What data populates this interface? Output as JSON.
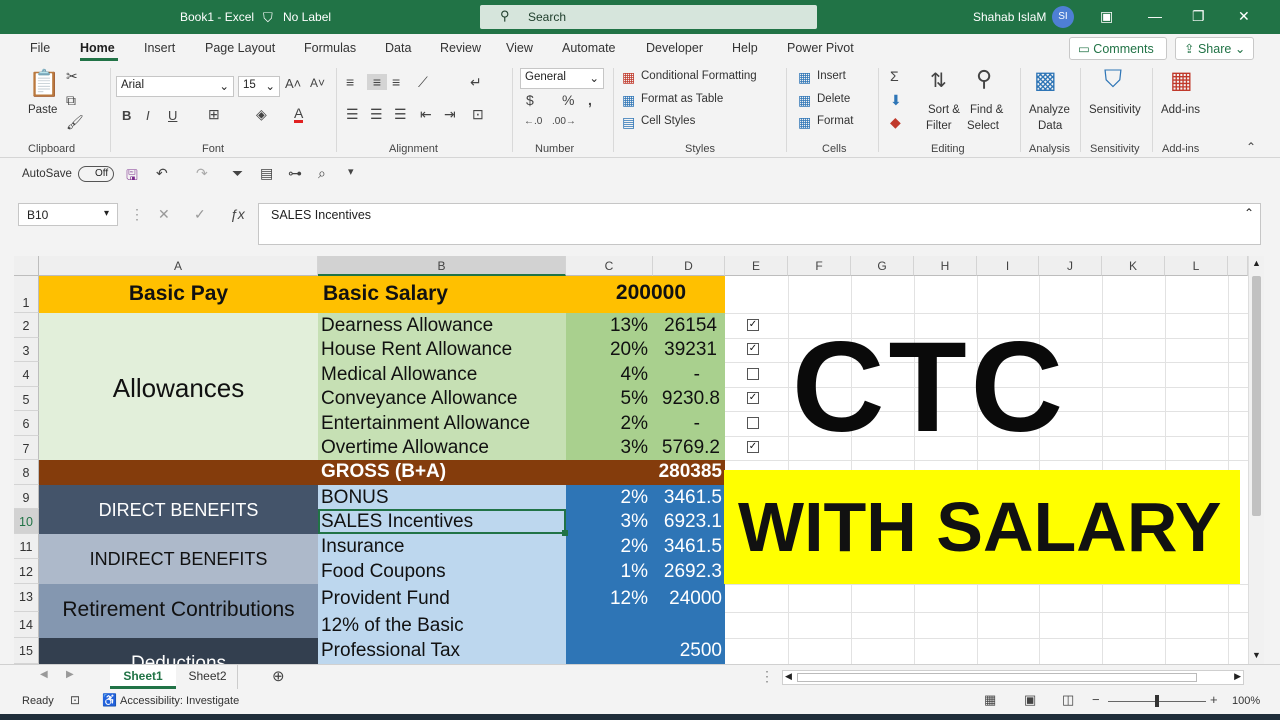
{
  "titlebar": {
    "app_title": "Book1 - Excel",
    "label": "No Label",
    "search_placeholder": "Search",
    "user_name": "Shahab IslaM",
    "user_initials": "SI"
  },
  "menu": [
    "File",
    "Home",
    "Insert",
    "Page Layout",
    "Formulas",
    "Data",
    "Review",
    "View",
    "Automate",
    "Developer",
    "Help",
    "Power Pivot"
  ],
  "top_buttons": {
    "comments": "Comments",
    "share": "Share"
  },
  "ribbon": {
    "clipboard": {
      "paste": "Paste",
      "group": "Clipboard"
    },
    "font": {
      "name": "Arial",
      "size": "15",
      "group": "Font",
      "bold": "B",
      "italic": "I",
      "underline": "U"
    },
    "alignment": {
      "group": "Alignment"
    },
    "number": {
      "format": "General",
      "group": "Number"
    },
    "styles": {
      "conditional": "Conditional Formatting",
      "table": "Format as Table",
      "cell": "Cell Styles",
      "group": "Styles"
    },
    "cells": {
      "insert": "Insert",
      "delete": "Delete",
      "format": "Format",
      "group": "Cells"
    },
    "editing": {
      "sort1": "Sort &",
      "sort2": "Filter",
      "find1": "Find &",
      "find2": "Select",
      "group": "Editing"
    },
    "analysis": {
      "analyze1": "Analyze",
      "analyze2": "Data",
      "group": "Analysis"
    },
    "sensitivity": {
      "label": "Sensitivity",
      "group": "Sensitivity"
    },
    "addins": {
      "label": "Add-ins",
      "group": "Add-ins"
    }
  },
  "qat": {
    "autosave": "AutoSave",
    "toggle": "Off"
  },
  "formula_bar": {
    "name_box": "B10",
    "formula": "SALES Incentives"
  },
  "columns": [
    "A",
    "B",
    "C",
    "D",
    "E",
    "F",
    "G",
    "H",
    "I",
    "J",
    "K",
    "L"
  ],
  "rows": [
    "1",
    "2",
    "3",
    "4",
    "5",
    "6",
    "7",
    "8",
    "9",
    "10",
    "11",
    "12",
    "13",
    "14",
    "15"
  ],
  "cells": {
    "a1": "Basic Pay",
    "b1": "Basic Salary",
    "c1": "200000",
    "a_allow": "Allowances",
    "b2": "Dearness Allowance",
    "c2": "13%",
    "d2": "26154",
    "b3": "House Rent Allowance",
    "c3": "20%",
    "d3": "39231",
    "b4": "Medical Allowance",
    "c4": "4%",
    "d4": "-",
    "b5": "Conveyance Allowance",
    "c5": "5%",
    "d5": "9230.8",
    "b6": "Entertainment Allowance",
    "c6": "2%",
    "d6": "-",
    "b7": "Overtime Allowance",
    "c7": "3%",
    "d7": "5769.2",
    "b8": "GROSS (B+A)",
    "d8": "280385",
    "a9": "DIRECT BENEFITS",
    "b9": "BONUS",
    "c9": "2%",
    "d9": "3461.5",
    "b10": "SALES Incentives",
    "c10": "3%",
    "d10": "6923.1",
    "a11": "INDIRECT BENEFITS",
    "b11": "Insurance",
    "c11": "2%",
    "d11": "3461.5",
    "b12": "Food Coupons",
    "c12": "1%",
    "d12": "2692.3",
    "a13": "Retirement Contributions",
    "b13": "Provident Fund",
    "c13": "12%",
    "d13": "24000",
    "b14": "12% of the Basic",
    "a15": "Deductions",
    "b15": "Professional Tax",
    "d15": "2500"
  },
  "checkboxes": [
    true,
    true,
    false,
    true,
    false,
    true
  ],
  "overlay": {
    "big": "CTC",
    "banner": "WITH SALARY",
    "banner_color": "#ffff00"
  },
  "sheets": [
    "Sheet1",
    "Sheet2"
  ],
  "status": {
    "ready": "Ready",
    "accessibility": "Accessibility: Investigate",
    "zoom": "100%"
  },
  "colors": {
    "excel_green": "#217346",
    "gold": "#ffc000",
    "light_green": "#c6e0b4",
    "mid_green": "#a9d08e",
    "brown": "#843c0c",
    "dark_slate": "#44546a",
    "light_blue": "#bdd7ee",
    "mid_blue": "#2e75b6"
  }
}
